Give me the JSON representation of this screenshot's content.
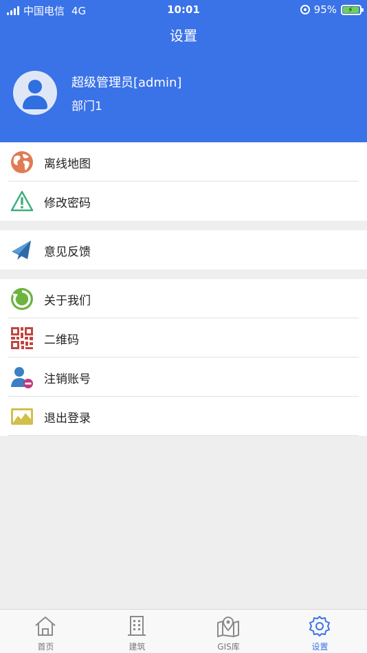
{
  "status_bar": {
    "carrier": "中国电信",
    "network": "4G",
    "time": "10:01",
    "battery": "95%",
    "battery_level": 0.95
  },
  "header": {
    "title": "设置",
    "user_name": "超级管理员[admin]",
    "department": "部门1",
    "background_color": "#3a72e8"
  },
  "menu": {
    "group1": [
      {
        "label": "离线地图",
        "icon": "globe-icon"
      },
      {
        "label": "修改密码",
        "icon": "warning-icon"
      }
    ],
    "group2": [
      {
        "label": "意见反馈",
        "icon": "mail-icon"
      }
    ],
    "group3": [
      {
        "label": "关于我们",
        "icon": "refresh-icon"
      },
      {
        "label": "二维码",
        "icon": "qr-code-icon"
      },
      {
        "label": "注销账号",
        "icon": "user-remove-icon"
      },
      {
        "label": "退出登录",
        "icon": "image-icon"
      }
    ]
  },
  "tab_bar": {
    "tabs": [
      {
        "label": "首页",
        "icon": "home-icon"
      },
      {
        "label": "建筑",
        "icon": "building-icon"
      },
      {
        "label": "GIS库",
        "icon": "map-pin-icon"
      },
      {
        "label": "设置",
        "icon": "gear-icon"
      }
    ],
    "active_index": 3,
    "active_color": "#3a72e8"
  }
}
